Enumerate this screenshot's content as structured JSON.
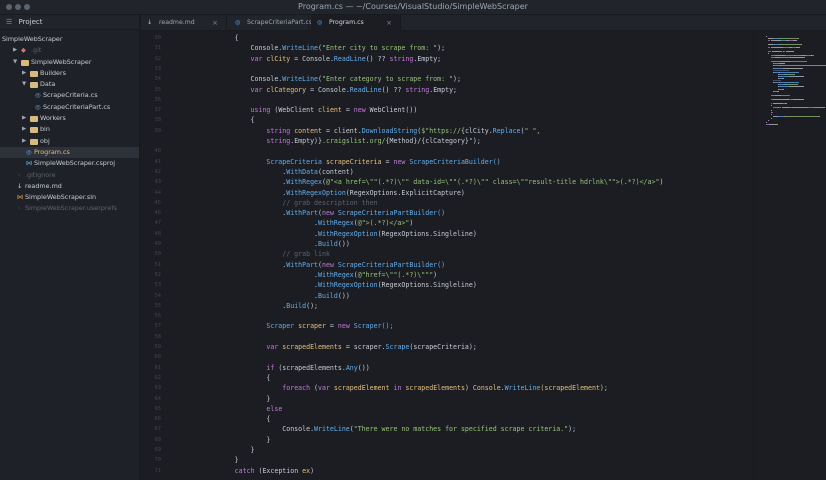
{
  "window": {
    "title": "Program.cs — ~/Courses/VisualStudio/SimpleWebScraper"
  },
  "sidebar": {
    "header": "Project",
    "items": [
      {
        "label": "SimpleWebScraper",
        "level": 0,
        "kind": "root"
      },
      {
        "label": ".git",
        "level": 1,
        "kind": "git",
        "muted": true
      },
      {
        "label": "SimpleWebScraper",
        "level": 1,
        "kind": "folder",
        "expanded": true
      },
      {
        "label": "Builders",
        "level": 2,
        "kind": "folder",
        "expanded": false
      },
      {
        "label": "Data",
        "level": 2,
        "kind": "folder",
        "expanded": true
      },
      {
        "label": "ScrapeCriteria.cs",
        "level": 3,
        "kind": "cs"
      },
      {
        "label": "ScrapeCriteriaPart.cs",
        "level": 3,
        "kind": "cs"
      },
      {
        "label": "Workers",
        "level": 2,
        "kind": "folder",
        "expanded": false
      },
      {
        "label": "bin",
        "level": 2,
        "kind": "folder",
        "expanded": false
      },
      {
        "label": "obj",
        "level": 2,
        "kind": "folder",
        "expanded": false
      },
      {
        "label": "Program.cs",
        "level": 2,
        "kind": "cs",
        "selected": true
      },
      {
        "label": "SimpleWebScraper.csproj",
        "level": 2,
        "kind": "proj"
      },
      {
        "label": ".gitignore",
        "level": 1,
        "kind": "file",
        "muted": true
      },
      {
        "label": "readme.md",
        "level": 1,
        "kind": "md"
      },
      {
        "label": "SimpleWebScraper.sln",
        "level": 1,
        "kind": "sln"
      },
      {
        "label": "SimpleWebScraper.userprefs",
        "level": 1,
        "kind": "file",
        "muted": true
      }
    ]
  },
  "tabs": [
    {
      "label": "readme.md",
      "icon": "markdown-icon",
      "active": false
    },
    {
      "label": "ScrapeCriteriaPart.cs",
      "icon": "csharp-file-icon",
      "active": false
    },
    {
      "label": "Program.cs",
      "icon": "csharp-file-icon",
      "active": true
    }
  ],
  "colors": {
    "keyword": "#c678dd",
    "type": "#e5c07b",
    "method": "#61afef",
    "string": "#98c379",
    "comment": "#5c6370",
    "default": "#c8ccd4",
    "variable": "#e06c75"
  },
  "editor": {
    "line_numbers": [
      "30",
      "31",
      "32",
      "33",
      "34",
      "35",
      "36",
      "37",
      "38",
      "39",
      "",
      "40",
      "41",
      "42",
      "43",
      "44",
      "45",
      "46",
      "47",
      "48",
      "49",
      "50",
      "51",
      "52",
      "53",
      "54",
      "55",
      "56",
      "57",
      "58",
      "59",
      "60",
      "61",
      "62",
      "63",
      "64",
      "65",
      "66",
      "67",
      "68",
      "69",
      "70",
      "71"
    ],
    "lines": [
      [
        {
          "t": "            {",
          "c": "default"
        }
      ],
      [
        {
          "t": "                Console.",
          "c": "default"
        },
        {
          "t": "WriteLine",
          "c": "method"
        },
        {
          "t": "(",
          "c": "default"
        },
        {
          "t": "\"Enter city to scrape from: \"",
          "c": "string"
        },
        {
          "t": ");",
          "c": "default"
        }
      ],
      [
        {
          "t": "                ",
          "c": "default"
        },
        {
          "t": "var",
          "c": "keyword"
        },
        {
          "t": " clCity ",
          "c": "type"
        },
        {
          "t": "= Console.",
          "c": "default"
        },
        {
          "t": "ReadLine",
          "c": "method"
        },
        {
          "t": "() ?? ",
          "c": "default"
        },
        {
          "t": "string",
          "c": "keyword"
        },
        {
          "t": ".Empty;",
          "c": "default"
        }
      ],
      [
        {
          "t": "",
          "c": "default"
        }
      ],
      [
        {
          "t": "                Console.",
          "c": "default"
        },
        {
          "t": "WriteLine",
          "c": "method"
        },
        {
          "t": "(",
          "c": "default"
        },
        {
          "t": "\"Enter category to scrape from: \"",
          "c": "string"
        },
        {
          "t": ");",
          "c": "default"
        }
      ],
      [
        {
          "t": "                ",
          "c": "default"
        },
        {
          "t": "var",
          "c": "keyword"
        },
        {
          "t": " clCategory ",
          "c": "type"
        },
        {
          "t": "= Console.",
          "c": "default"
        },
        {
          "t": "ReadLine",
          "c": "method"
        },
        {
          "t": "() ?? ",
          "c": "default"
        },
        {
          "t": "string",
          "c": "keyword"
        },
        {
          "t": ".Empty;",
          "c": "default"
        }
      ],
      [
        {
          "t": "",
          "c": "default"
        }
      ],
      [
        {
          "t": "                ",
          "c": "default"
        },
        {
          "t": "using",
          "c": "keyword"
        },
        {
          "t": " (WebClient ",
          "c": "default"
        },
        {
          "t": "client",
          "c": "type"
        },
        {
          "t": " = ",
          "c": "default"
        },
        {
          "t": "new",
          "c": "keyword"
        },
        {
          "t": " WebClient())",
          "c": "default"
        }
      ],
      [
        {
          "t": "                {",
          "c": "default"
        }
      ],
      [
        {
          "t": "                    ",
          "c": "default"
        },
        {
          "t": "string",
          "c": "keyword"
        },
        {
          "t": " content ",
          "c": "type"
        },
        {
          "t": "= client.",
          "c": "default"
        },
        {
          "t": "DownloadString",
          "c": "method"
        },
        {
          "t": "(",
          "c": "default"
        },
        {
          "t": "$\"https://",
          "c": "string"
        },
        {
          "t": "{clCity.",
          "c": "default"
        },
        {
          "t": "Replace",
          "c": "method"
        },
        {
          "t": "(",
          "c": "default"
        },
        {
          "t": "\" \",",
          "c": "string"
        }
      ],
      [
        {
          "t": "                    ",
          "c": "default"
        },
        {
          "t": "string",
          "c": "keyword"
        },
        {
          "t": ".Empty)}",
          "c": "default"
        },
        {
          "t": ".craigslist.org/",
          "c": "string"
        },
        {
          "t": "{Method}/{clCategory}",
          "c": "default"
        },
        {
          "t": "\"",
          "c": "string"
        },
        {
          "t": ");",
          "c": "default"
        }
      ],
      [
        {
          "t": "",
          "c": "default"
        }
      ],
      [
        {
          "t": "                    ScrapeCriteria ",
          "c": "method"
        },
        {
          "t": "scrapeCriteria",
          "c": "type"
        },
        {
          "t": " = ",
          "c": "default"
        },
        {
          "t": "new",
          "c": "keyword"
        },
        {
          "t": " ScrapeCriteriaBuilder()",
          "c": "method"
        }
      ],
      [
        {
          "t": "                        .",
          "c": "default"
        },
        {
          "t": "WithData",
          "c": "method"
        },
        {
          "t": "(content)",
          "c": "default"
        }
      ],
      [
        {
          "t": "                        .",
          "c": "default"
        },
        {
          "t": "WithRegex",
          "c": "method"
        },
        {
          "t": "(",
          "c": "default"
        },
        {
          "t": "@\"<a href=\\\"\"(.*?)\\\"\" data-id=\\\"\"(.*?)\\\"\" class=\\\"\"result-title hdrlnk\\\"\">(.*?)</a>\"",
          "c": "string"
        },
        {
          "t": ")",
          "c": "default"
        }
      ],
      [
        {
          "t": "                        .",
          "c": "default"
        },
        {
          "t": "WithRegexOption",
          "c": "method"
        },
        {
          "t": "(RegexOptions.ExplicitCapture)",
          "c": "default"
        }
      ],
      [
        {
          "t": "                        // grab description then",
          "c": "comment"
        }
      ],
      [
        {
          "t": "                        .",
          "c": "default"
        },
        {
          "t": "WithPart",
          "c": "method"
        },
        {
          "t": "(",
          "c": "default"
        },
        {
          "t": "new",
          "c": "keyword"
        },
        {
          "t": " ScrapeCriteriaPartBuilder()",
          "c": "method"
        }
      ],
      [
        {
          "t": "                                .",
          "c": "default"
        },
        {
          "t": "WithRegex",
          "c": "method"
        },
        {
          "t": "(",
          "c": "default"
        },
        {
          "t": "@\">(.*?)</a>\"",
          "c": "string"
        },
        {
          "t": ")",
          "c": "default"
        }
      ],
      [
        {
          "t": "                                .",
          "c": "default"
        },
        {
          "t": "WithRegexOption",
          "c": "method"
        },
        {
          "t": "(RegexOptions.Singleline)",
          "c": "default"
        }
      ],
      [
        {
          "t": "                                .",
          "c": "default"
        },
        {
          "t": "Build",
          "c": "method"
        },
        {
          "t": "())",
          "c": "default"
        }
      ],
      [
        {
          "t": "                        // grab link",
          "c": "comment"
        }
      ],
      [
        {
          "t": "                        .",
          "c": "default"
        },
        {
          "t": "WithPart",
          "c": "method"
        },
        {
          "t": "(",
          "c": "default"
        },
        {
          "t": "new",
          "c": "keyword"
        },
        {
          "t": " ScrapeCriteriaPartBuilder()",
          "c": "method"
        }
      ],
      [
        {
          "t": "                                .",
          "c": "default"
        },
        {
          "t": "WithRegex",
          "c": "method"
        },
        {
          "t": "(",
          "c": "default"
        },
        {
          "t": "@\"href=\\\"\"(.*?)\\\"\"\"",
          "c": "string"
        },
        {
          "t": ")",
          "c": "default"
        }
      ],
      [
        {
          "t": "                                .",
          "c": "default"
        },
        {
          "t": "WithRegexOption",
          "c": "method"
        },
        {
          "t": "(RegexOptions.Singleline)",
          "c": "default"
        }
      ],
      [
        {
          "t": "                                .",
          "c": "default"
        },
        {
          "t": "Build",
          "c": "method"
        },
        {
          "t": "())",
          "c": "default"
        }
      ],
      [
        {
          "t": "                        .",
          "c": "default"
        },
        {
          "t": "Build",
          "c": "method"
        },
        {
          "t": "();",
          "c": "default"
        }
      ],
      [
        {
          "t": "",
          "c": "default"
        }
      ],
      [
        {
          "t": "                    Scraper ",
          "c": "method"
        },
        {
          "t": "scraper",
          "c": "type"
        },
        {
          "t": " = ",
          "c": "default"
        },
        {
          "t": "new",
          "c": "keyword"
        },
        {
          "t": " Scraper();",
          "c": "method"
        }
      ],
      [
        {
          "t": "",
          "c": "default"
        }
      ],
      [
        {
          "t": "                    ",
          "c": "default"
        },
        {
          "t": "var",
          "c": "keyword"
        },
        {
          "t": " scrapedElements ",
          "c": "type"
        },
        {
          "t": "= scraper.",
          "c": "default"
        },
        {
          "t": "Scrape",
          "c": "method"
        },
        {
          "t": "(scrapeCriteria);",
          "c": "default"
        }
      ],
      [
        {
          "t": "",
          "c": "default"
        }
      ],
      [
        {
          "t": "                    ",
          "c": "default"
        },
        {
          "t": "if",
          "c": "keyword"
        },
        {
          "t": " (scrapedElements.",
          "c": "default"
        },
        {
          "t": "Any",
          "c": "method"
        },
        {
          "t": "())",
          "c": "default"
        }
      ],
      [
        {
          "t": "                    {",
          "c": "default"
        }
      ],
      [
        {
          "t": "                        ",
          "c": "default"
        },
        {
          "t": "foreach",
          "c": "keyword"
        },
        {
          "t": " (",
          "c": "default"
        },
        {
          "t": "var",
          "c": "keyword"
        },
        {
          "t": " scrapedElement ",
          "c": "type"
        },
        {
          "t": "in",
          "c": "keyword"
        },
        {
          "t": " scrapedElements) Console.",
          "c": "type"
        },
        {
          "t": "WriteLine",
          "c": "method"
        },
        {
          "t": "(scrapedElement);",
          "c": "type"
        }
      ],
      [
        {
          "t": "                    }",
          "c": "default"
        }
      ],
      [
        {
          "t": "                    ",
          "c": "default"
        },
        {
          "t": "else",
          "c": "keyword"
        }
      ],
      [
        {
          "t": "                    {",
          "c": "default"
        }
      ],
      [
        {
          "t": "                        Console.",
          "c": "default"
        },
        {
          "t": "WriteLine",
          "c": "method"
        },
        {
          "t": "(",
          "c": "default"
        },
        {
          "t": "\"There were no matches for specified scrape criteria.\"",
          "c": "string"
        },
        {
          "t": ");",
          "c": "default"
        }
      ],
      [
        {
          "t": "                    }",
          "c": "default"
        }
      ],
      [
        {
          "t": "                }",
          "c": "default"
        }
      ],
      [
        {
          "t": "            }",
          "c": "default"
        }
      ],
      [
        {
          "t": "            ",
          "c": "default"
        },
        {
          "t": "catch",
          "c": "keyword"
        },
        {
          "t": " (Exception ",
          "c": "default"
        },
        {
          "t": "ex",
          "c": "type"
        },
        {
          "t": ")",
          "c": "default"
        }
      ]
    ]
  }
}
